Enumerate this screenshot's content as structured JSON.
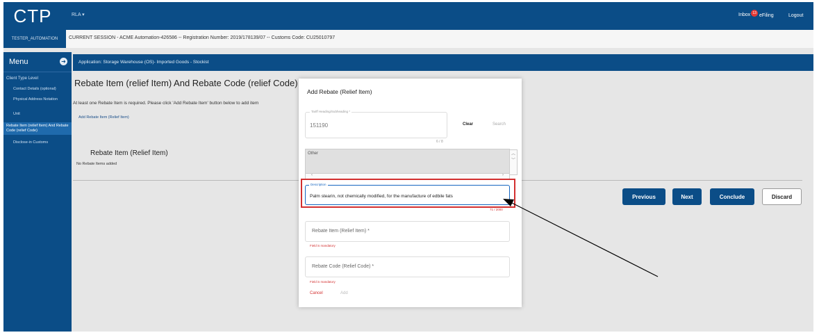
{
  "header": {
    "logo": "CTP",
    "user": "TESTER_AUTOMATION",
    "org_menu": "RLA ▾",
    "inbox_label": "Inbox",
    "inbox_count": "13",
    "efiling": "eFiling",
    "logout": "Logout",
    "session_info": "CURRENT SESSION - ACME Automation-426586 -- Registration Number: 2019/178139/07 -- Customs Code: CU25010797"
  },
  "sidebar": {
    "title": "Menu",
    "toggle_icon": "arrow-circle-icon",
    "level_label": "Client Type Level",
    "items": [
      {
        "label": "Contact Details (optional)"
      },
      {
        "label": "Physical Address Notation"
      },
      {
        "label": "Unit"
      },
      {
        "label": "Rebate Item (relief Item) And Rebate Code (relief Code)"
      },
      {
        "label": "Disclose-in Customs"
      }
    ]
  },
  "app_header": "Application: Storage Warehouse (OS)- Imported Goods - Stockist",
  "main": {
    "title": "Rebate Item (relief Item) And Rebate Code (relief Code)",
    "hint": "At least one Rebate Item is required. Please click 'Add Rebate Item' button below to add item",
    "add_link": "Add Rebate Item (Relief Item)",
    "panel_title": "Rebate Item (Relief Item)",
    "no_items": "No Rebate Items added",
    "buttons": {
      "previous": "Previous",
      "next": "Next",
      "conclude": "Conclude",
      "discard": "Discard"
    }
  },
  "dialog": {
    "title": "Add Rebate (Relief Item)",
    "tariff_label": "Tariff Heading/Subheading *",
    "tariff_value": "151190",
    "tariff_counter": "6 / 8",
    "clear": "Clear",
    "search": "Search",
    "other_text": "Other",
    "description_label": "Description",
    "description_value": "Palm stearin, not chemically modified, for the manufacture of edbile fats",
    "description_counter": "71 / 2000",
    "rebate_item_label": "Rebate Item (Relief Item) *",
    "rebate_item_error": "Field is mandatory",
    "rebate_code_label": "Rebate Code (Relief Code) *",
    "rebate_code_error": "Field is mandatory",
    "cancel": "Cancel",
    "add": "Add"
  },
  "colors": {
    "brand": "#0b4d87",
    "highlight": "#d32f2f",
    "focus": "#1565c0"
  }
}
